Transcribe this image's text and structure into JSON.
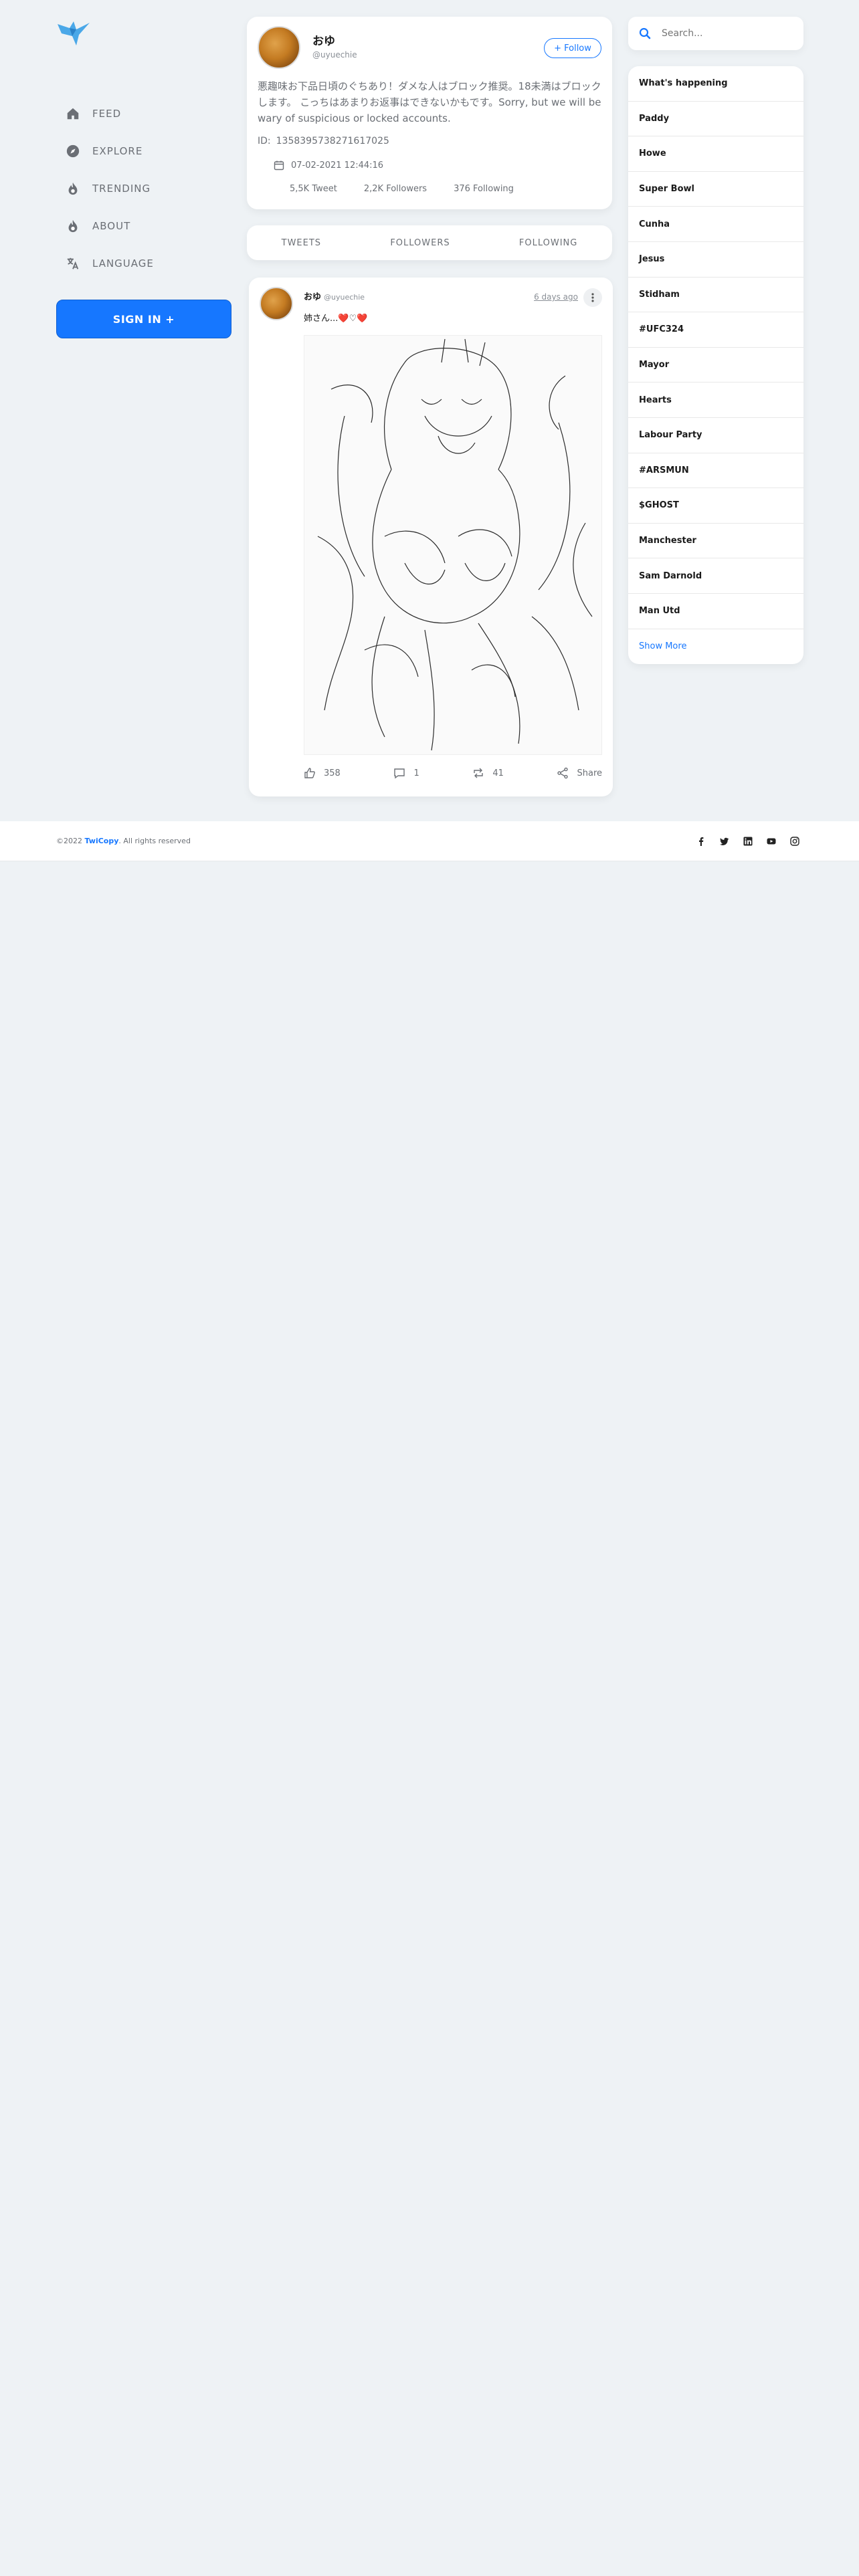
{
  "nav": {
    "items": [
      {
        "label": "FEED",
        "icon": "home-icon"
      },
      {
        "label": "EXPLORE",
        "icon": "compass-icon"
      },
      {
        "label": "TRENDING",
        "icon": "flame-icon"
      },
      {
        "label": "ABOUT",
        "icon": "flame-icon"
      },
      {
        "label": "LANGUAGE",
        "icon": "translate-icon"
      }
    ],
    "signin_label": "SIGN IN +"
  },
  "profile": {
    "name": "おゆ",
    "handle": "@uyuechie",
    "follow_label": "+ Follow",
    "bio": "悪趣味お下品日頃のぐちあり！ダメな人はブロック推奨。18未満はブロックします。 こっちはあまりお返事はできないかもです。Sorry, but we will be wary of suspicious or locked accounts.",
    "id_label": "ID:",
    "id_value": "1358395738271617025",
    "joined": "07-02-2021 12:44:16",
    "tweets": "5,5K Tweet",
    "followers": "2,2K Followers",
    "following": "376 Following"
  },
  "tabs": [
    "TWEETS",
    "FOLLOWERS",
    "FOLLOWING"
  ],
  "tweet": {
    "name": "おゆ",
    "handle": "@uyuechie",
    "ago": "6 days ago",
    "text": "姉さん...❤️♡❤️",
    "likes": "358",
    "comments": "1",
    "retweets": "41",
    "share_label": "Share"
  },
  "search": {
    "placeholder": "Search..."
  },
  "trends": {
    "header": "What's happening",
    "items": [
      "Paddy",
      "Howe",
      "Super Bowl",
      "Cunha",
      "Jesus",
      "Stidham",
      "#UFC324",
      "Mayor",
      "Hearts",
      "Labour Party",
      "#ARSMUN",
      "$GHOST",
      "Manchester",
      "Sam Darnold",
      "Man Utd"
    ],
    "more_label": "Show More"
  },
  "footer": {
    "prefix": "©2022 ",
    "brand": "TwiCopy",
    "suffix": ". All rights reserved"
  },
  "colors": {
    "accent": "#1677ff",
    "background": "#eef2f5"
  }
}
